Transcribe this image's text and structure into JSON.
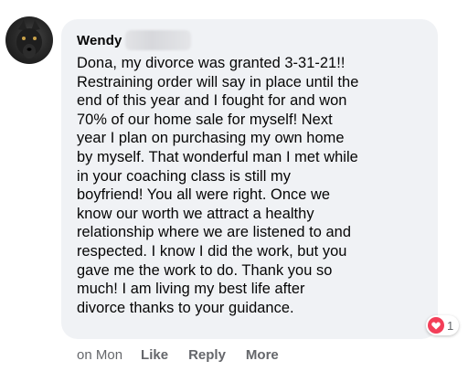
{
  "comment": {
    "author": "Wendy",
    "text": "Dona, my divorce was granted 3-31-21!!\nRestraining order will say in place until the\nend of this year and I fought for and won\n70% of our home sale for myself! Next\nyear I plan on purchasing my own home\nby myself. That wonderful man I met while\nin your coaching class is still my\nboyfriend! You all were right. Once we\nknow our worth we attract a healthy\nrelationship where we are listened to and\nrespected. I know I did the work, but you\ngave me the work to do. Thank you so\nmuch! I am living my best life after\ndivorce thanks to your guidance.",
    "reaction_icon": "love-icon",
    "reaction_count": "1",
    "timestamp": "on Mon",
    "actions": {
      "like": "Like",
      "reply": "Reply",
      "more": "More"
    }
  },
  "colors": {
    "bubble_bg": "#f0f2f5",
    "text": "#050505",
    "meta_text": "#65676b",
    "love_red": "#f33e58"
  }
}
